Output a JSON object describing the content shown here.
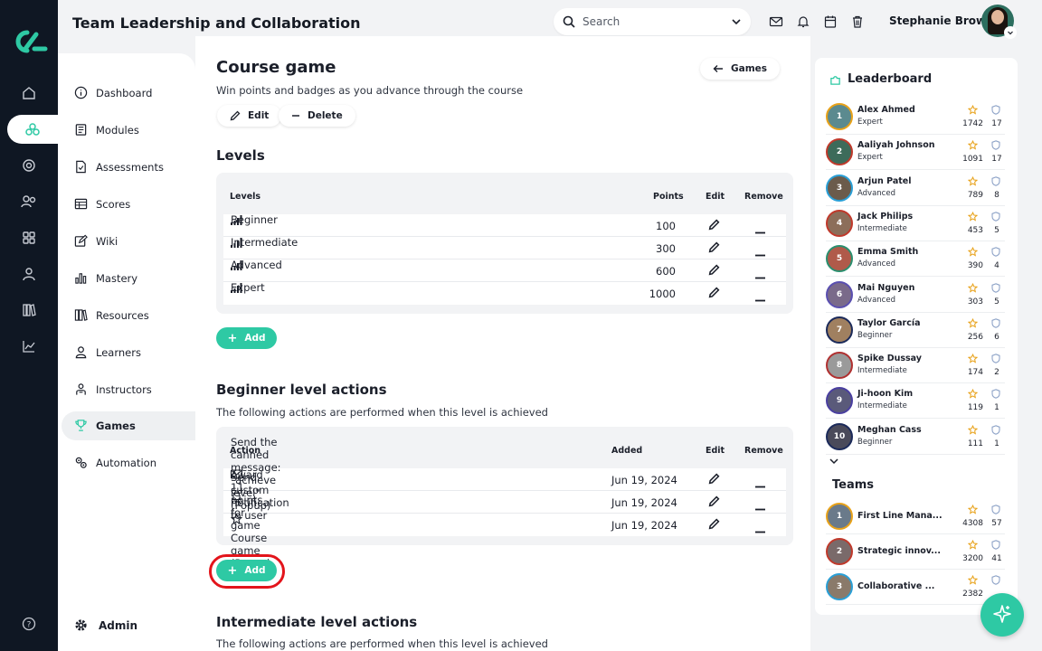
{
  "app": {
    "title": "Team Leadership and Collaboration",
    "user_name": "Stephanie Brown",
    "search_placeholder": "Search",
    "accent": "#2ec9a4",
    "rail_icons": [
      "home-icon",
      "modules-icon",
      "target-icon",
      "people-icon",
      "grid-icon",
      "user-icon",
      "library-icon",
      "chart-icon",
      "help-icon"
    ]
  },
  "nav": {
    "items": [
      {
        "label": "Dashboard",
        "icon": "info-icon"
      },
      {
        "label": "Modules",
        "icon": "book-icon"
      },
      {
        "label": "Assessments",
        "icon": "file-check-icon"
      },
      {
        "label": "Scores",
        "icon": "table-icon"
      },
      {
        "label": "Wiki",
        "icon": "edit-icon"
      },
      {
        "label": "Mastery",
        "icon": "bar-chart-icon"
      },
      {
        "label": "Resources",
        "icon": "books-icon"
      },
      {
        "label": "Learners",
        "icon": "user-icon"
      },
      {
        "label": "Instructors",
        "icon": "instructor-icon"
      },
      {
        "label": "Games",
        "icon": "trophy-icon",
        "active": true
      },
      {
        "label": "Automation",
        "icon": "gears-icon"
      }
    ],
    "admin_label": "Admin"
  },
  "page": {
    "title": "Course game",
    "subtitle": "Win points and badges as you advance through the course",
    "back_label": "Games",
    "edit_label": "Edit",
    "delete_label": "Delete"
  },
  "levels": {
    "heading": "Levels",
    "columns": {
      "name": "Levels",
      "points": "Points",
      "edit": "Edit",
      "remove": "Remove"
    },
    "rows": [
      {
        "name": "Beginner",
        "points": "100"
      },
      {
        "name": "Intermediate",
        "points": "300"
      },
      {
        "name": "Advanced",
        "points": "600"
      },
      {
        "name": "Expert",
        "points": "1000"
      }
    ],
    "add_label": "Add"
  },
  "beginner_actions": {
    "heading": "Beginner level actions",
    "description": "The following actions are performed when this level is achieved",
    "columns": {
      "action": "Action",
      "added": "Added",
      "edit": "Edit",
      "remove": "Remove"
    },
    "rows": [
      {
        "icon": "mail-icon",
        "action": "Send the canned message: \"achieve level\" (Popup)",
        "added": "Jun 19, 2024"
      },
      {
        "icon": "bell-icon",
        "action": "Send custom notification to user",
        "added": "Jun 19, 2024"
      },
      {
        "icon": "star-outline-icon",
        "action": "Award 11 points for game Course game (Popup)",
        "added": "Jun 19, 2024"
      }
    ],
    "add_label": "Add"
  },
  "intermediate_actions": {
    "heading": "Intermediate level actions",
    "description": "The following actions are performed when this level is achieved"
  },
  "leaderboard": {
    "title": "Leaderboard",
    "entries": [
      {
        "name": "Alex Ahmed",
        "level": "Expert",
        "points": "1742",
        "badges": "17",
        "ring": "#e8a21a",
        "bg": "#5b8a8f",
        "rank": "1"
      },
      {
        "name": "Aaliyah Johnson",
        "level": "Expert",
        "points": "1091",
        "badges": "17",
        "ring": "#c0392b",
        "bg": "#3d6b5a",
        "rank": "2"
      },
      {
        "name": "Arjun Patel",
        "level": "Advanced",
        "points": "789",
        "badges": "8",
        "ring": "#2a9fd6",
        "bg": "#6b5b4b",
        "rank": "3"
      },
      {
        "name": "Jack Philips",
        "level": "Intermediate",
        "points": "453",
        "badges": "5",
        "ring": "#c0392b",
        "bg": "#8c6e5a",
        "rank": "4"
      },
      {
        "name": "Emma Smith",
        "level": "Advanced",
        "points": "390",
        "badges": "4",
        "ring": "#2a8f6f",
        "bg": "#b05a4a",
        "rank": "5"
      },
      {
        "name": "Mai Nguyen",
        "level": "Advanced",
        "points": "303",
        "badges": "5",
        "ring": "#5a4fb0",
        "bg": "#7a6a8a",
        "rank": "6"
      },
      {
        "name": "Taylor García",
        "level": "Beginner",
        "points": "256",
        "badges": "6",
        "ring": "#1b2a5a",
        "bg": "#a08060",
        "rank": "7"
      },
      {
        "name": "Spike Dussay",
        "level": "Intermediate",
        "points": "174",
        "badges": "2",
        "ring": "#b03030",
        "bg": "#9a9a9a",
        "rank": "8"
      },
      {
        "name": "Ji-hoon Kim",
        "level": "Intermediate",
        "points": "119",
        "badges": "1",
        "ring": "#4a3fa0",
        "bg": "#5a5a7a",
        "rank": "9"
      },
      {
        "name": "Meghan Cass",
        "level": "Beginner",
        "points": "111",
        "badges": "1",
        "ring": "#1b2a5a",
        "bg": "#4a4a5a",
        "rank": "10"
      }
    ],
    "teams_title": "Teams",
    "teams": [
      {
        "name": "First Line Mana...",
        "points": "4308",
        "badges": "57",
        "ring": "#e8a21a",
        "bg": "#6a7a8a",
        "rank": "1"
      },
      {
        "name": "Strategic innov...",
        "points": "3200",
        "badges": "41",
        "ring": "#c0392b",
        "bg": "#7a6a6a",
        "rank": "2"
      },
      {
        "name": "Collaborative ...",
        "points": "2382",
        "badges": "",
        "ring": "#2a9fd6",
        "bg": "#8a7a6a",
        "rank": "3"
      }
    ]
  }
}
